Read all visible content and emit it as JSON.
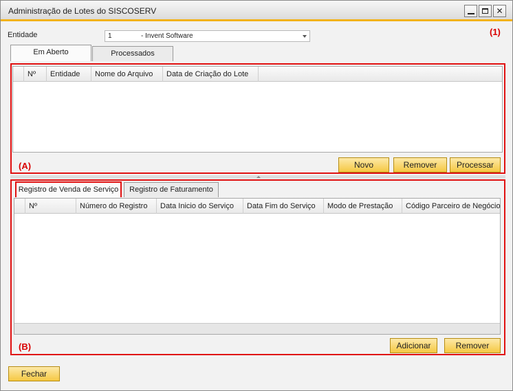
{
  "window": {
    "title": "Administração de Lotes do SISCOSERV"
  },
  "markers": {
    "m1": "(1)",
    "mA": "(A)",
    "mB": "(B)"
  },
  "entity": {
    "label": "Entidade",
    "code": "1",
    "name": "- Invent Software"
  },
  "top_tabs": [
    {
      "label": "Em Aberto",
      "active": true
    },
    {
      "label": "Processados",
      "active": false
    }
  ],
  "batches_grid": {
    "columns": [
      "",
      "Nº",
      "Entidade",
      "Nome do Arquivo",
      "Data de Criação do Lote"
    ],
    "rows": []
  },
  "batch_buttons": {
    "new": "Novo",
    "remove": "Remover",
    "process": "Processar"
  },
  "detail_tabs": [
    {
      "label": "Registro de Venda de Serviço",
      "active": true
    },
    {
      "label": "Registro de Faturamento",
      "active": false
    }
  ],
  "records_grid": {
    "columns": [
      "",
      "Nº",
      "Número do Registro",
      "Data Inicio do Serviço",
      "Data Fim do Serviço",
      "Modo de Prestação",
      "Código Parceiro de Negócios"
    ],
    "rows": []
  },
  "record_buttons": {
    "add": "Adicionar",
    "remove": "Remover"
  },
  "footer": {
    "close": "Fechar"
  },
  "colors": {
    "accent": "#f2b21b",
    "button": "#f5c842",
    "highlight": "#e01010"
  }
}
